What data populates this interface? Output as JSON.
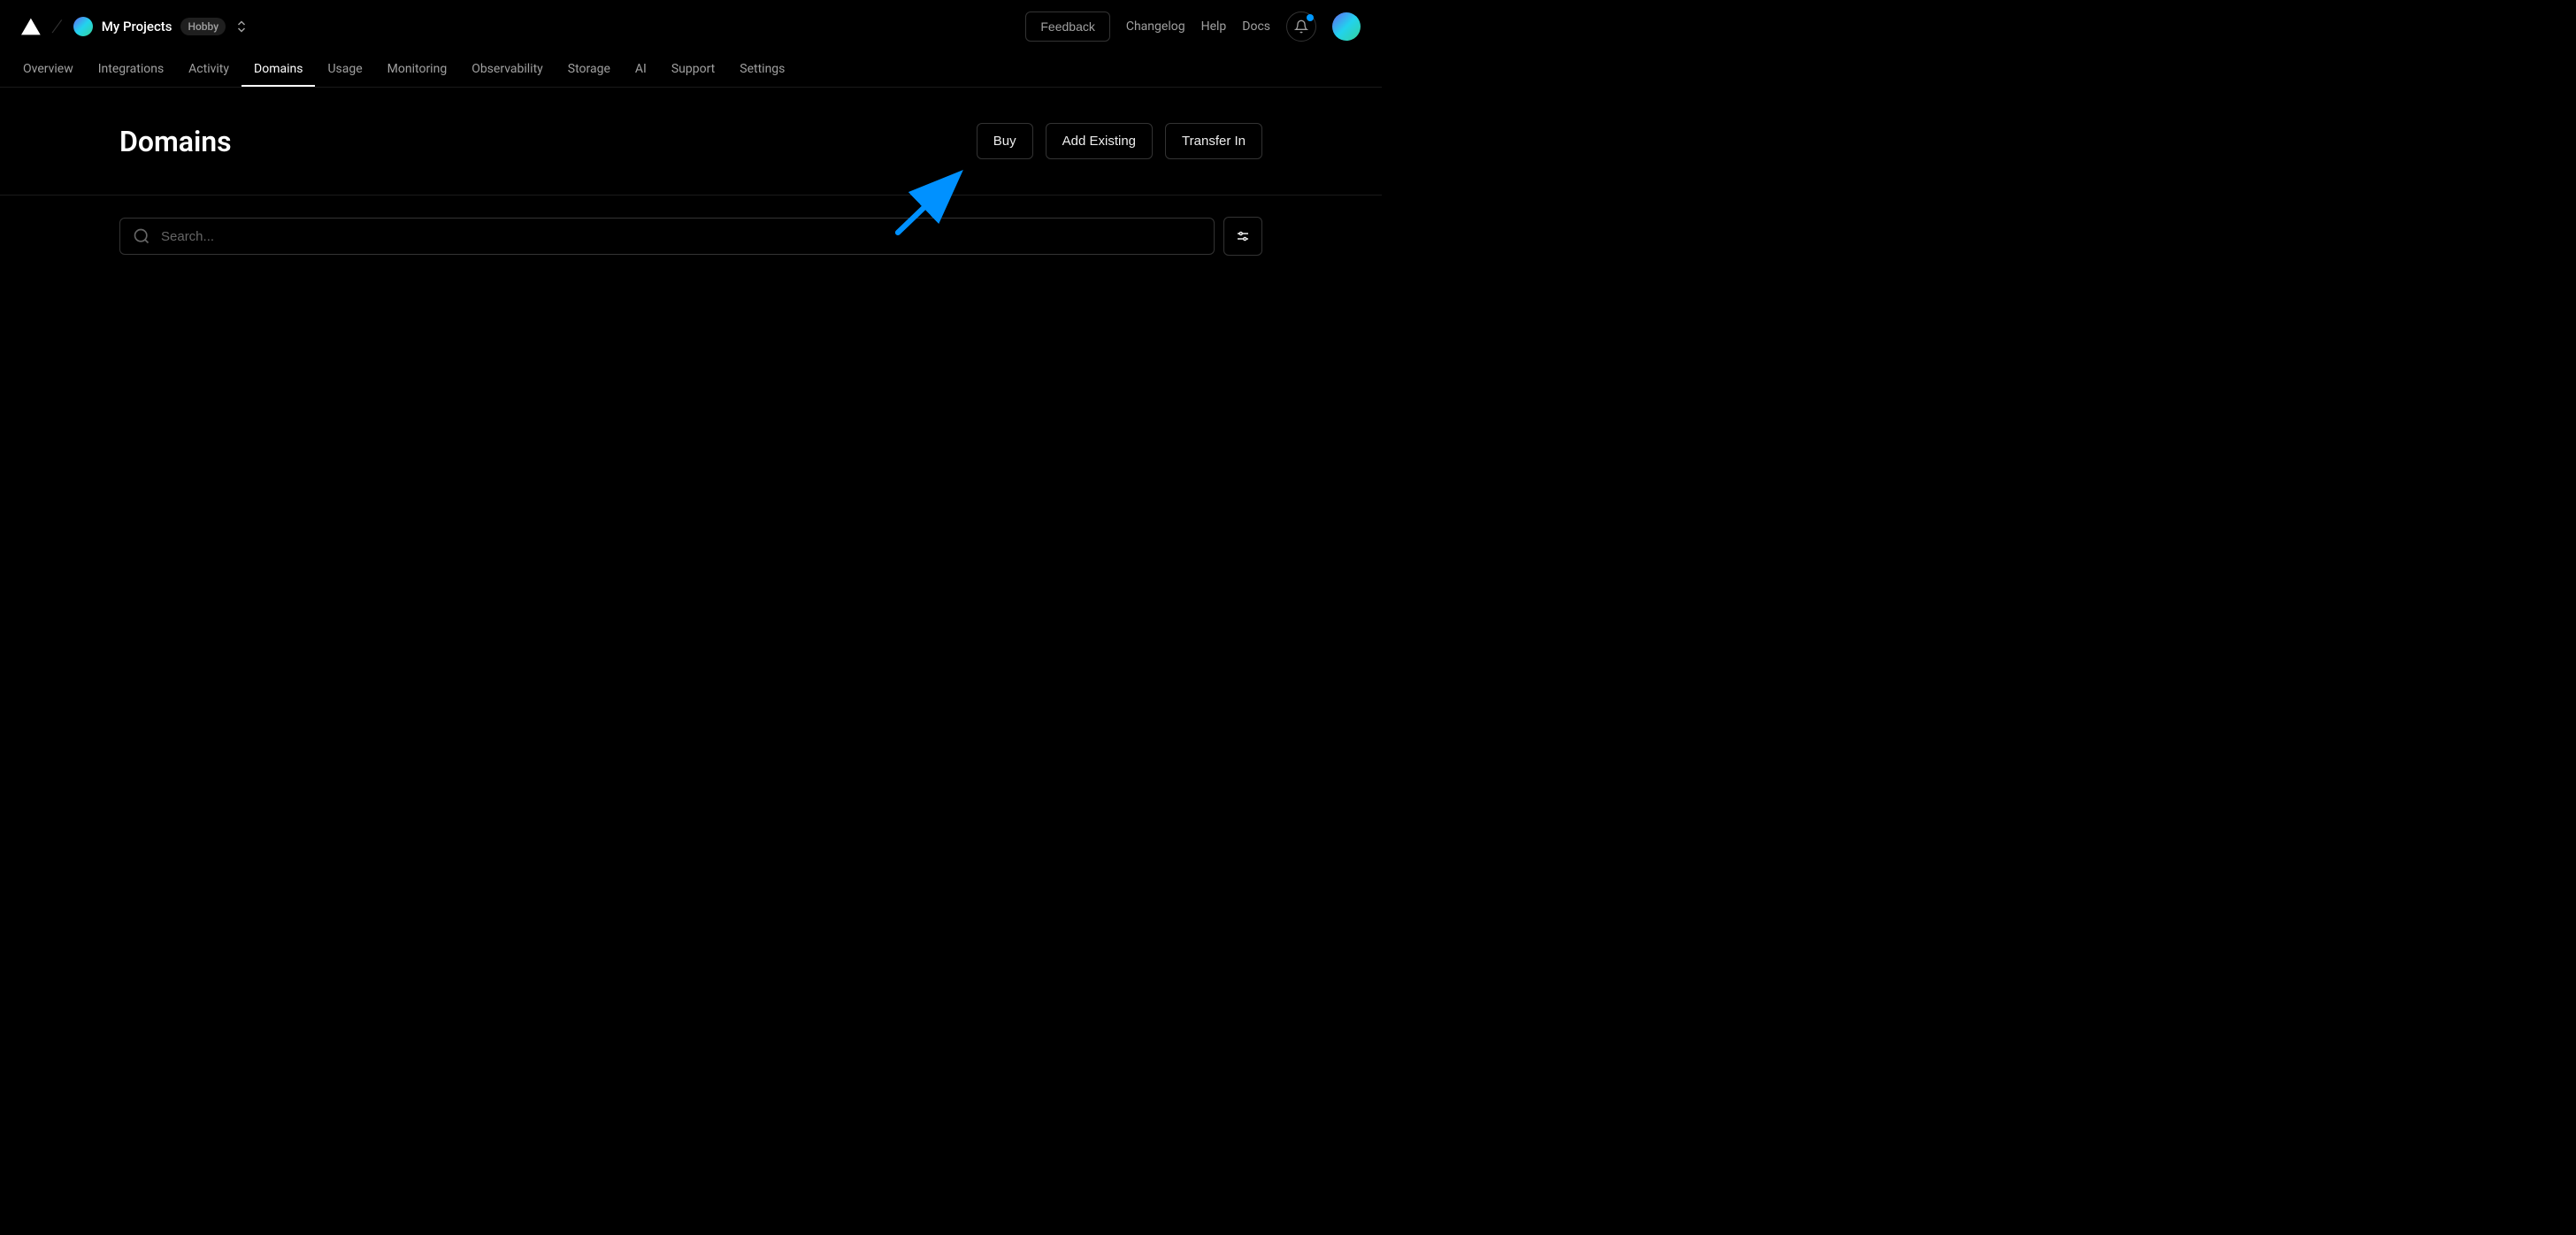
{
  "header": {
    "team_name": "My Projects",
    "plan_badge": "Hobby",
    "feedback_label": "Feedback",
    "changelog_label": "Changelog",
    "help_label": "Help",
    "docs_label": "Docs"
  },
  "tabs": [
    {
      "label": "Overview",
      "active": false
    },
    {
      "label": "Integrations",
      "active": false
    },
    {
      "label": "Activity",
      "active": false
    },
    {
      "label": "Domains",
      "active": true
    },
    {
      "label": "Usage",
      "active": false
    },
    {
      "label": "Monitoring",
      "active": false
    },
    {
      "label": "Observability",
      "active": false
    },
    {
      "label": "Storage",
      "active": false
    },
    {
      "label": "AI",
      "active": false
    },
    {
      "label": "Support",
      "active": false
    },
    {
      "label": "Settings",
      "active": false
    }
  ],
  "page": {
    "title": "Domains",
    "actions": {
      "buy": "Buy",
      "add_existing": "Add Existing",
      "transfer_in": "Transfer In"
    }
  },
  "search": {
    "placeholder": "Search..."
  },
  "colors": {
    "background": "#000000",
    "border": "#333333",
    "text_muted": "#a0a0a0",
    "accent": "#0099ff"
  }
}
